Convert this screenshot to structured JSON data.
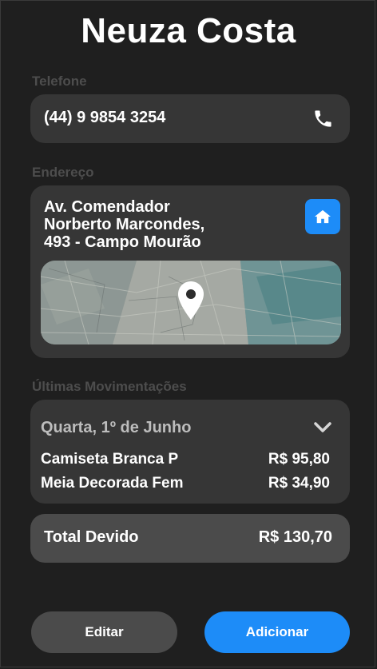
{
  "contact": {
    "name": "Neuza Costa"
  },
  "phone": {
    "label": "Telefone",
    "value": "(44) 9 9854 3254",
    "icon": "phone-icon"
  },
  "address": {
    "label": "Endereço",
    "lines": [
      "Av. Comendador",
      "Norberto Marcondes,",
      "493 - Campo Mourão"
    ],
    "home_icon": "home-icon",
    "map_icon": "map-pin-icon"
  },
  "movements": {
    "label": "Últimas Movimentações",
    "date": "Quarta, 1º de Junho",
    "items": [
      {
        "name": "Camiseta Branca P",
        "price": "R$ 95,80"
      },
      {
        "name": "Meia Decorada Fem",
        "price": "R$ 34,90"
      }
    ]
  },
  "total": {
    "label": "Total Devido",
    "value": "R$ 130,70"
  },
  "actions": {
    "edit_label": "Editar",
    "add_label": "Adicionar"
  },
  "colors": {
    "accent": "#1d8cf8",
    "background": "#1f1f1f",
    "card": "#363636"
  }
}
